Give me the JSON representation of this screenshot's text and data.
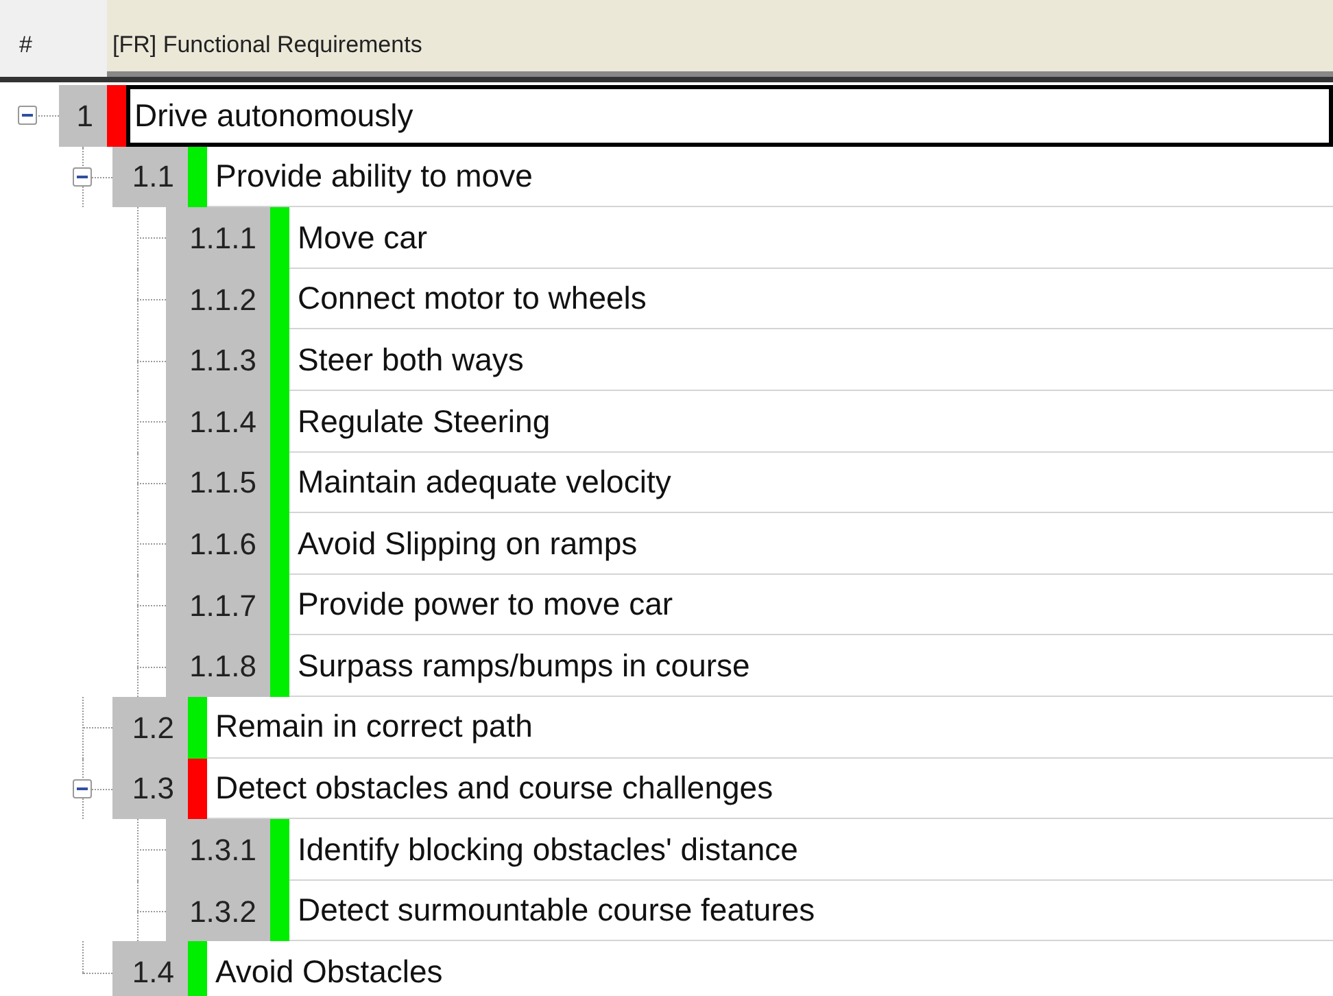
{
  "header": {
    "number_column": "#",
    "title_column": "[FR] Functional Requirements"
  },
  "requirements": [
    {
      "number": "1",
      "text": "Drive autonomously",
      "color": "#ff0000",
      "selected": true,
      "expanded": true,
      "children": [
        {
          "number": "1.1",
          "text": "Provide ability to move",
          "color": "#00ee00",
          "selected": false,
          "expanded": true,
          "children": [
            {
              "number": "1.1.1",
              "text": "Move car",
              "color": "#00ee00",
              "selected": false
            },
            {
              "number": "1.1.2",
              "text": "Connect motor to wheels",
              "color": "#00ee00",
              "selected": false
            },
            {
              "number": "1.1.3",
              "text": "Steer both ways",
              "color": "#00ee00",
              "selected": false
            },
            {
              "number": "1.1.4",
              "text": "Regulate Steering",
              "color": "#00ee00",
              "selected": false
            },
            {
              "number": "1.1.5",
              "text": "Maintain adequate velocity",
              "color": "#00ee00",
              "selected": false
            },
            {
              "number": "1.1.6",
              "text": "Avoid Slipping on ramps",
              "color": "#00ee00",
              "selected": false
            },
            {
              "number": "1.1.7",
              "text": "Provide power to move car",
              "color": "#00ee00",
              "selected": false
            },
            {
              "number": "1.1.8",
              "text": "Surpass ramps/bumps in course",
              "color": "#00ee00",
              "selected": false
            }
          ]
        },
        {
          "number": "1.2",
          "text": "Remain in correct path",
          "color": "#00ee00",
          "selected": false
        },
        {
          "number": "1.3",
          "text": "Detect obstacles and course challenges",
          "color": "#ff0000",
          "selected": false,
          "expanded": true,
          "children": [
            {
              "number": "1.3.1",
              "text": "Identify blocking obstacles' distance",
              "color": "#00ee00",
              "selected": false
            },
            {
              "number": "1.3.2",
              "text": "Detect surmountable course features",
              "color": "#00ee00",
              "selected": false
            }
          ]
        },
        {
          "number": "1.4",
          "text": "Avoid Obstacles",
          "color": "#00ee00",
          "selected": false
        }
      ]
    }
  ]
}
